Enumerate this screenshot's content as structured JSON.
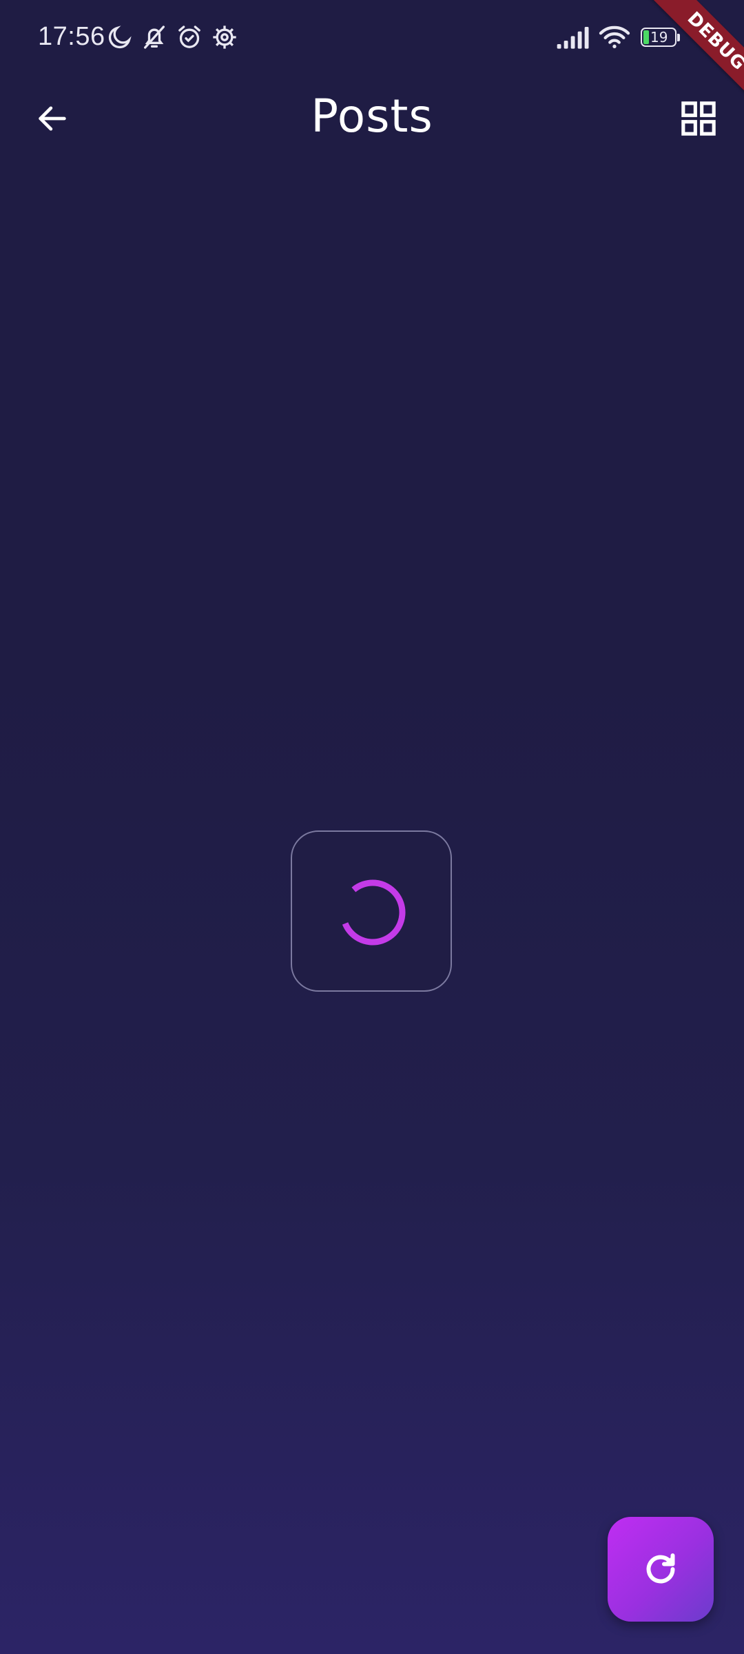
{
  "status_bar": {
    "time": "17:56",
    "icons": [
      "moon-icon",
      "bell-off-icon",
      "alarm-icon",
      "settings-gear-icon",
      "signal-icon",
      "wifi-icon"
    ],
    "battery_level": "19"
  },
  "debug_banner": {
    "label": "DEBUG",
    "color": "#8a1c2a"
  },
  "app_bar": {
    "title": "Posts",
    "back_icon": "arrow-left-icon",
    "view_toggle_icon": "grid-view-icon"
  },
  "loading": {
    "state": "loading",
    "accent_color": "#c43be8"
  },
  "fab": {
    "icon": "refresh-icon",
    "colors": [
      "#c02ef2",
      "#6b3ccc"
    ]
  },
  "theme": {
    "background": "#1f1c44",
    "text": "#ffffff"
  }
}
